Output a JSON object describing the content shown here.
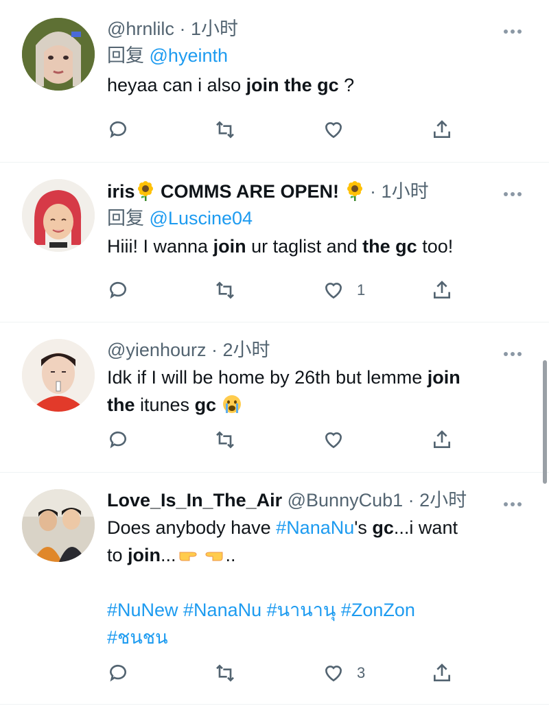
{
  "tweets": [
    {
      "name": "",
      "handle": "@hrnlilc",
      "time": "1小时",
      "reply_prefix": "回复",
      "reply_to": "@hyeinth",
      "text_a": "heyaa can i also ",
      "text_b": "join the gc",
      "text_c": " ?",
      "likes": ""
    },
    {
      "name_a": "iris",
      "name_b": " COMMS ARE OPEN! ",
      "time": "1小时",
      "reply_prefix": "回复",
      "reply_to": "@Luscine04",
      "text_a": "Hiii! I wanna ",
      "text_b": "join",
      "text_c": " ur taglist and ",
      "text_d": "the gc",
      "text_e": " too!",
      "likes": "1"
    },
    {
      "handle": "@yienhourz",
      "time": "2小时",
      "line1_a": "Idk if I will be home by 26th but lemme ",
      "line1_b": "join",
      "line2_a": "the",
      "line2_b": " itunes ",
      "line2_c": "gc",
      "likes": ""
    },
    {
      "name": "Love_Is_In_The_Air",
      "handle": "@BunnyCub1",
      "time": "2小时",
      "line1_a": "Does anybody have ",
      "line1_tag": "#NanaNu",
      "line1_b": "'s ",
      "line1_c": "gc",
      "line1_d": "...i want",
      "line2_a": "to ",
      "line2_b": "join",
      "line2_c": "...",
      "line2_d": "..",
      "tags1": "#NuNew #NanaNu #นานานุ #ZonZon",
      "tags2": "#ชนชน",
      "likes": "3"
    }
  ],
  "separator": " · ",
  "colors": {
    "accent": "#1d9bf0",
    "muted": "#536471",
    "text": "#0f1419"
  },
  "icons": [
    "reply-icon",
    "retweet-icon",
    "like-icon",
    "share-icon",
    "more-icon",
    "sunflower-emoji",
    "crying-emoji",
    "pointing-right-emoji",
    "pointing-left-emoji"
  ]
}
